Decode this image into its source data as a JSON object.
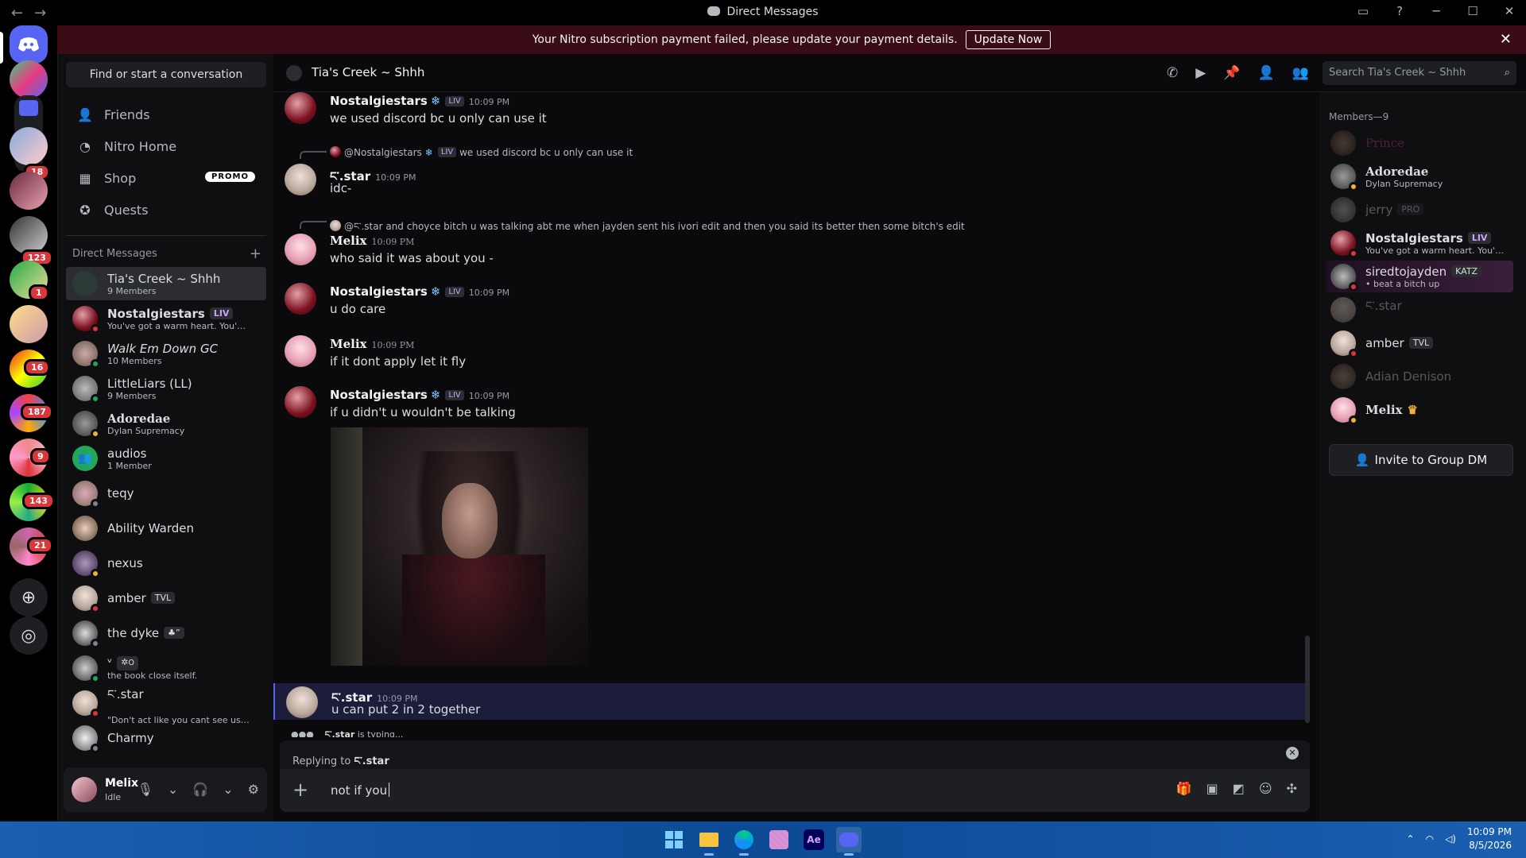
{
  "window": {
    "title": "Direct Messages"
  },
  "banner": {
    "text": "Your Nitro subscription payment failed, please update your payment details.",
    "button": "Update Now"
  },
  "rail_badges": [
    "18",
    "123",
    "1",
    "16",
    "187",
    "9",
    "143",
    "21"
  ],
  "sidebar": {
    "find": "Find or start a conversation",
    "nav": [
      {
        "label": "Friends",
        "icon": "friends-icon"
      },
      {
        "label": "Nitro Home",
        "icon": "nitro-icon"
      },
      {
        "label": "Shop",
        "icon": "shop-icon",
        "badge": "PROMO"
      },
      {
        "label": "Quests",
        "icon": "quests-icon"
      }
    ],
    "dm_header": "Direct Messages",
    "dms": [
      {
        "name": "Tia's Creek ~ Shhh",
        "sub": "9 Members"
      },
      {
        "name": "Nostalgiestars",
        "tag": "LIV",
        "sub": "You've got a warm heart. You've..."
      },
      {
        "name": "Walk Em Down GC",
        "sub": "10 Members"
      },
      {
        "name": "LittleLiars (LL)",
        "sub": "9 Members"
      },
      {
        "name": "Adoredae",
        "sub": "Dylan Supremacy"
      },
      {
        "name": "audios",
        "sub": "1 Member"
      },
      {
        "name": "teqy",
        "sub": ""
      },
      {
        "name": "Ability Warden",
        "sub": ""
      },
      {
        "name": "nexus",
        "sub": ""
      },
      {
        "name": "amber",
        "tag": "TVL",
        "sub": ""
      },
      {
        "name": "the dyke",
        "tag": "♣”",
        "sub": ""
      },
      {
        "name": "ᵛ",
        "tag": "✲౦",
        "sub": "the book close itself."
      },
      {
        "name": "ང་.star",
        "sub": "\"Don't act like you cant see us bitch\""
      },
      {
        "name": "Charmy",
        "sub": ""
      }
    ]
  },
  "user": {
    "name": "Melix",
    "status": "Idle"
  },
  "channel": {
    "title": "Tia's Creek ~ Shhh",
    "search": "Search Tia's Creek ~ Shhh"
  },
  "messages": [
    {
      "author": "Nostalgiestars",
      "tag": "LIV",
      "time": "10:09 PM",
      "text": "we used discord bc u only can use it"
    },
    {
      "reply_to": "@Nostalgiestars",
      "reply_tag": "LIV",
      "reply_text": "we used discord bc u only can use it",
      "author": "ང་.star",
      "time": "10:09 PM",
      "text": "idc-"
    },
    {
      "reply_to": "@ང་.star",
      "reply_text": "and choyce bitch u was talking abt me when jayden sent his ivori edit and then you said its better then some bitch's edit",
      "author": "Melix",
      "time": "10:09 PM",
      "text": "who said it was about you -"
    },
    {
      "author": "Nostalgiestars",
      "tag": "LIV",
      "time": "10:09 PM",
      "text": "u do care"
    },
    {
      "author": "Melix",
      "time": "10:09 PM",
      "text": "if it dont apply let it fly"
    },
    {
      "author": "Nostalgiestars",
      "tag": "LIV",
      "time": "10:09 PM",
      "text": "if u didn't u wouldn't be talking"
    },
    {
      "author": "ང་.star",
      "time": "10:09 PM",
      "text": "u can put 2 in 2 together"
    }
  ],
  "typing": {
    "who": "ང་.star",
    "text": " is typing..."
  },
  "composer": {
    "replying_label": "Replying to ",
    "replying_to": "ང་.star",
    "value": "not if you"
  },
  "members": {
    "header": "Members—9",
    "list": [
      {
        "name": "Prince",
        "sub": ""
      },
      {
        "name": "Adoredae",
        "sub": "Dylan Supremacy"
      },
      {
        "name": "jerry",
        "tag": "PRO",
        "sub": ""
      },
      {
        "name": "Nostalgiestars",
        "tag": "LIV",
        "sub": "You've got a warm heart. You'v..."
      },
      {
        "name": "siredtojayden",
        "tag": "KATZ",
        "sub": "• beat a bitch up"
      },
      {
        "name": "ང་.star",
        "sub": ""
      },
      {
        "name": "amber",
        "tag": "TVL",
        "sub": ""
      },
      {
        "name": "Adian Denison",
        "sub": ""
      },
      {
        "name": "Melix",
        "sub": ""
      }
    ],
    "invite": "Invite to Group DM"
  },
  "taskbar": {
    "time": "10:09 PM",
    "date": "8/5/2026",
    "apps": [
      "start-icon",
      "file-explorer-icon",
      "edge-icon",
      "photos-icon",
      "after-effects-icon",
      "discord-icon"
    ]
  }
}
